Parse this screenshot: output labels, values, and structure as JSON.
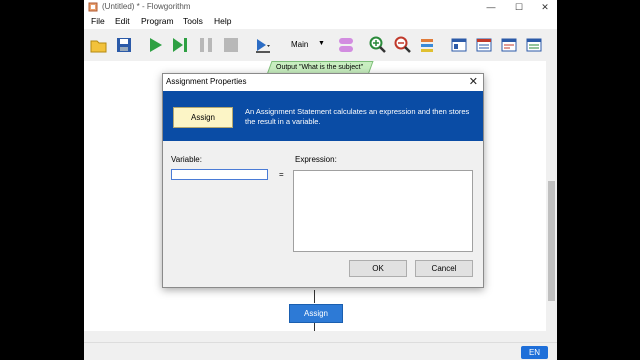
{
  "window": {
    "title": "(Untitled) * - Flowgorithm",
    "minimize": "—",
    "maximize": "☐",
    "close": "✕"
  },
  "menu": [
    "File",
    "Edit",
    "Program",
    "Tools",
    "Help"
  ],
  "toolbar": {
    "function_select": "Main",
    "icons": [
      "open-icon",
      "save-icon",
      "run-icon",
      "step-icon",
      "pause-icon",
      "stop-icon",
      "run-speed-icon",
      "variables-icon",
      "zoom-in-icon",
      "zoom-out-icon",
      "layout-icon",
      "panel-a-icon",
      "panel-b-icon",
      "panel-c-icon",
      "panel-d-icon"
    ]
  },
  "canvas": {
    "output_shape": "Output \"What is the subject\"",
    "assign_shape": "Assign"
  },
  "status": {
    "language": "EN"
  },
  "dialog": {
    "title": "Assignment Properties",
    "close": "✕",
    "banner_label": "Assign",
    "banner_text": "An Assignment Statement calculates an expression and then stores the result in a variable.",
    "variable_label": "Variable:",
    "variable_value": "",
    "equals": "=",
    "expression_label": "Expression:",
    "expression_value": "",
    "ok": "OK",
    "cancel": "Cancel"
  },
  "colors": {
    "banner": "#0a4ca5",
    "assign_shape": "#2d7ad6",
    "output_shape": "#c8eec0",
    "language_badge": "#1e6fd9"
  }
}
